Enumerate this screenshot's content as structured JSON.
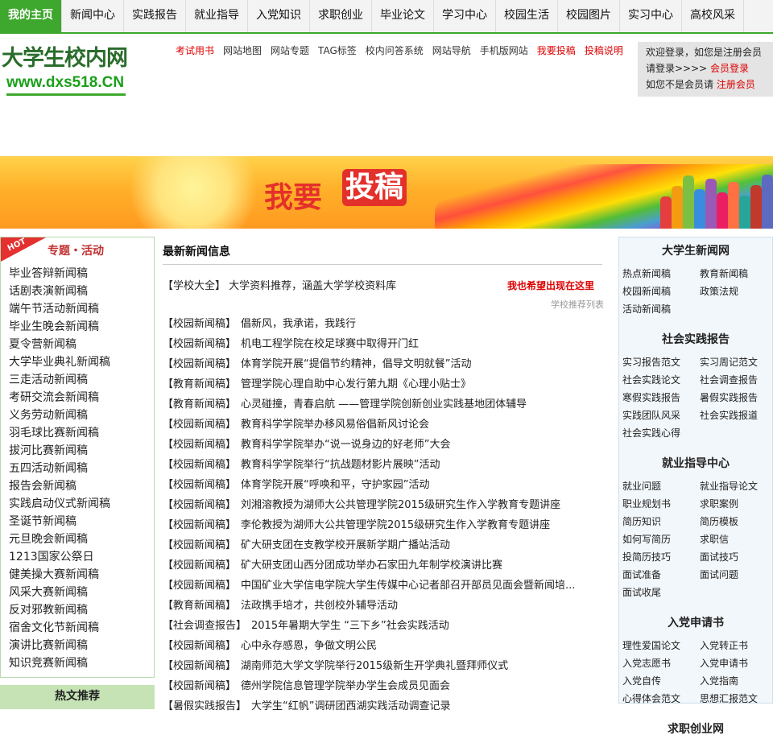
{
  "topnav": [
    "我的主页",
    "新闻中心",
    "实践报告",
    "就业指导",
    "入党知识",
    "求职创业",
    "毕业论文",
    "学习中心",
    "校园生活",
    "校园图片",
    "实习中心",
    "高校风采"
  ],
  "logo": {
    "line1": "大学生校内网",
    "line2": "www.dxs518.CN"
  },
  "toplinks": [
    {
      "label": "考试用书",
      "red": true
    },
    {
      "label": "网站地图",
      "red": false
    },
    {
      "label": "网站专题",
      "red": false
    },
    {
      "label": "TAG标签",
      "red": false
    },
    {
      "label": "校内问答系统",
      "red": false
    },
    {
      "label": "网站导航",
      "red": false
    },
    {
      "label": "手机版网站",
      "red": false
    },
    {
      "label": "我要投稿",
      "red": true
    },
    {
      "label": "投稿说明",
      "red": true
    }
  ],
  "login": {
    "line1": "欢迎登录，如您是注册会员",
    "line2_prefix": "请登录>>>> ",
    "login_link": "会员登录",
    "line3_prefix": "如您不是会员请 ",
    "register_link": "注册会员"
  },
  "banner": {
    "text1": "我要",
    "text2": "投稿"
  },
  "left": {
    "hot_badge": "HOT",
    "title": "专题・活动",
    "items": [
      "毕业答辩新闻稿",
      "话剧表演新闻稿",
      "端午节活动新闻稿",
      "毕业生晚会新闻稿",
      "夏令营新闻稿",
      "大学毕业典礼新闻稿",
      "三走活动新闻稿",
      "考研交流会新闻稿",
      "义务劳动新闻稿",
      "羽毛球比赛新闻稿",
      "拔河比赛新闻稿",
      "五四活动新闻稿",
      "报告会新闻稿",
      "实践启动仪式新闻稿",
      "圣诞节新闻稿",
      "元旦晚会新闻稿",
      "1213国家公祭日",
      "健美操大赛新闻稿",
      "风采大赛新闻稿",
      "反对邪教新闻稿",
      "宿舍文化节新闻稿",
      "演讲比赛新闻稿",
      "知识竞赛新闻稿"
    ],
    "hot_recommend": "热文推荐"
  },
  "center": {
    "title": "最新新闻信息",
    "featured": {
      "category": "【学校大全】",
      "text": "大学资料推荐，涵盖大学学校资料库"
    },
    "hope": "我也希望出现在这里",
    "rec_list": "学校推荐列表",
    "news": [
      {
        "category": "【校园新闻稿】",
        "text": "倡新风，我承诺，我践行"
      },
      {
        "category": "【校园新闻稿】",
        "text": "机电工程学院在校足球赛中取得开门红"
      },
      {
        "category": "【校园新闻稿】",
        "text": "体育学院开展“提倡节约精神，倡导文明就餐”活动"
      },
      {
        "category": "【教育新闻稿】",
        "text": "管理学院心理自助中心发行第九期《心理小贴士》"
      },
      {
        "category": "【教育新闻稿】",
        "text": "心灵碰撞，青春启航 ——管理学院创新创业实践基地团体辅导"
      },
      {
        "category": "【校园新闻稿】",
        "text": "教育科学学院举办移风易俗倡新风讨论会"
      },
      {
        "category": "【校园新闻稿】",
        "text": "教育科学学院举办“说一说身边的好老师”大会"
      },
      {
        "category": "【校园新闻稿】",
        "text": "教育科学学院举行“抗战题材影片展映”活动"
      },
      {
        "category": "【校园新闻稿】",
        "text": "体育学院开展“呼唤和平，守护家园”活动"
      },
      {
        "category": "【校园新闻稿】",
        "text": "刘湘溶教授为湖师大公共管理学院2015级研究生作入学教育专题讲座"
      },
      {
        "category": "【校园新闻稿】",
        "text": "李伦教授为湖师大公共管理学院2015级研究生作入学教育专题讲座"
      },
      {
        "category": "【校园新闻稿】",
        "text": "矿大研支团在支教学校开展新学期广播站活动"
      },
      {
        "category": "【校园新闻稿】",
        "text": "矿大研支团山西分团成功举办石家田九年制学校演讲比赛"
      },
      {
        "category": "【校园新闻稿】",
        "text": "中国矿业大学信电学院大学生传媒中心记者部召开部员见面会暨新闻培..."
      },
      {
        "category": "【教育新闻稿】",
        "text": "法政携手培才，共创校外辅导活动"
      },
      {
        "category": "【社会调查报告】",
        "text": "2015年暑期大学生 “三下乡”社会实践活动"
      },
      {
        "category": "【校园新闻稿】",
        "text": "心中永存感恩，争做文明公民"
      },
      {
        "category": "【校园新闻稿】",
        "text": "湖南师范大学文学院举行2015级新生开学典礼暨拜师仪式"
      },
      {
        "category": "【校园新闻稿】",
        "text": "德州学院信息管理学院举办学生会成员见面会"
      },
      {
        "category": "【暑假实践报告】",
        "text": "大学生“红帆”调研团西湖实践活动调查记录"
      }
    ]
  },
  "right": {
    "sections": [
      {
        "title": "大学生新闻网",
        "items": [
          "热点新闻稿",
          "教育新闻稿",
          "校园新闻稿",
          "政策法规",
          "活动新闻稿"
        ]
      },
      {
        "title": "社会实践报告",
        "items": [
          "实习报告范文",
          "实习周记范文",
          "社会实践论文",
          "社会调查报告",
          "寒假实践报告",
          "暑假实践报告",
          "实践团队风采",
          "社会实践报道",
          "社会实践心得"
        ]
      },
      {
        "title": "就业指导中心",
        "items": [
          "就业问题",
          "就业指导论文",
          "职业规划书",
          "求职案例",
          "简历知识",
          "简历模板",
          "如何写简历",
          "求职信",
          "投简历技巧",
          "面试技巧",
          "面试准备",
          "面试问题",
          "面试收尾"
        ]
      },
      {
        "title": "入党申请书",
        "items": [
          "理性爱国论文",
          "入党转正书",
          "入党志愿书",
          "入党申请书",
          "入党自传",
          "入党指南",
          "心得体会范文",
          "思想汇报范文"
        ]
      },
      {
        "title": "求职创业网",
        "items": []
      }
    ]
  },
  "colors": {
    "green": "#3ea72d",
    "red": "#dd0000",
    "banner_orange": "#ffb02a"
  }
}
